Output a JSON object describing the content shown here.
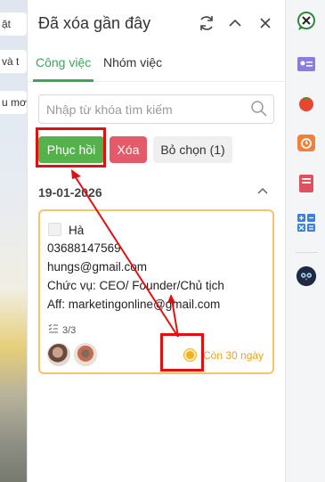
{
  "background": {
    "fragments": [
      "ặt",
      "và t",
      "u mơ"
    ]
  },
  "panel": {
    "title": "Đã xóa gần đây",
    "header_icons": [
      "refresh-icon",
      "chevron-up-icon",
      "close-icon"
    ]
  },
  "tabs": [
    {
      "label": "Công việc",
      "active": true
    },
    {
      "label": "Nhóm việc",
      "active": false
    }
  ],
  "search": {
    "placeholder": "Nhập từ khóa tìm kiếm"
  },
  "actions": {
    "restore_label": "Phục hồi",
    "delete_label": "Xóa",
    "deselect_label": "Bỏ chọn (1)"
  },
  "group": {
    "date": "19-01-2026"
  },
  "card": {
    "name": "Hà",
    "phone": "03688147569",
    "email": "hungs@gmail.com",
    "position": "Chức vụ: CEO/ Founder/Chủ tịch",
    "aff": "Aff: marketingonline@gmail.com",
    "subtasks": "3/3",
    "remaining": "Còn 30 ngày"
  },
  "colors": {
    "accent": "#3aa657",
    "restore_bg": "#55b24b",
    "delete_bg": "#e55a6b",
    "card_border": "#f3c46a",
    "status": "#f3b21a",
    "annotation": "#e01010"
  },
  "sidebar_icons": [
    "chat-app-icon",
    "contact-card-icon",
    "tomato-icon",
    "timer-icon",
    "notebook-icon",
    "calculator-icon",
    "owl-avatar-icon"
  ]
}
